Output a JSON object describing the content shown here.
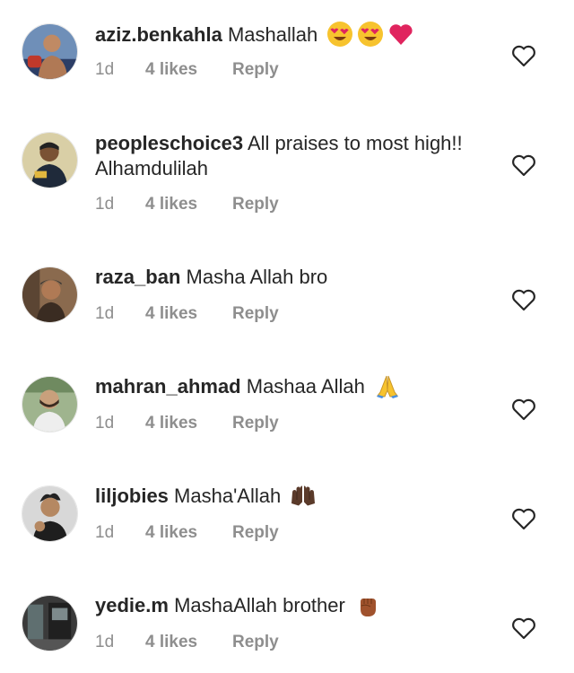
{
  "comments": [
    {
      "username": "aziz.benkahla",
      "text": "Mashallah",
      "emojis": [
        "heart-eyes-emoji",
        "heart-eyes-emoji",
        "red-heart-emoji"
      ],
      "time": "1d",
      "likes": "4 likes",
      "reply": "Reply"
    },
    {
      "username": "peopleschoice3",
      "text": "All praises to most high!! Alhamdulilah",
      "emojis": [],
      "time": "1d",
      "likes": "4 likes",
      "reply": "Reply"
    },
    {
      "username": "raza_ban",
      "text": "Masha Allah bro",
      "emojis": [],
      "time": "1d",
      "likes": "4 likes",
      "reply": "Reply"
    },
    {
      "username": "mahran_ahmad",
      "text": "Mashaa Allah",
      "emojis": [
        "folded-hands-emoji"
      ],
      "time": "1d",
      "likes": "4 likes",
      "reply": "Reply"
    },
    {
      "username": "liljobies",
      "text": "Masha'Allah",
      "emojis": [
        "raised-hands-dark-emoji"
      ],
      "time": "1d",
      "likes": "4 likes",
      "reply": "Reply"
    },
    {
      "username": "yedie.m",
      "text": "MashaAllah brother",
      "emojis": [
        "raised-fist-emoji"
      ],
      "time": "1d",
      "likes": "4 likes",
      "reply": "Reply"
    }
  ],
  "colors": {
    "text": "#262626",
    "meta": "#8e8e8e",
    "heart_outline": "#262626",
    "red_heart": "#e0245e",
    "emoji_yellow": "#f7c32e"
  }
}
